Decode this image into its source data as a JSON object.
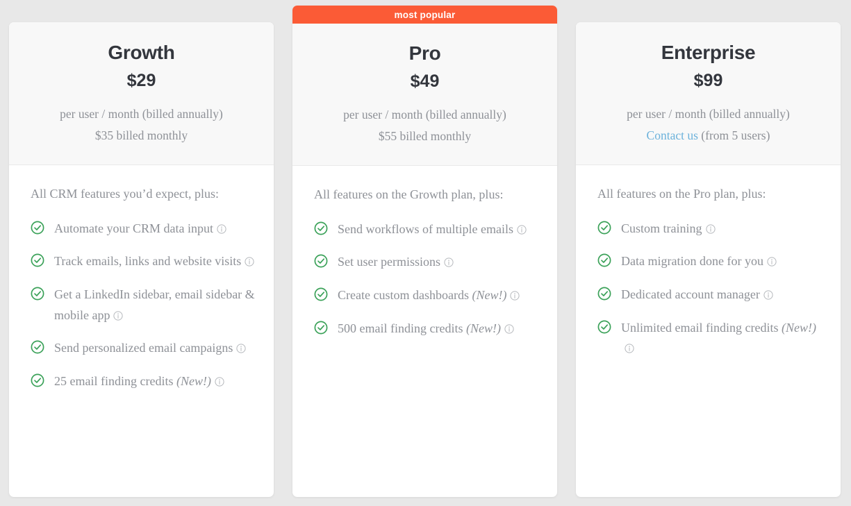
{
  "page": {
    "background_color": "#e8e8e8",
    "accent_orange": "#fb5b36",
    "check_green": "#3aa158",
    "link_blue": "#6cb2db",
    "text_gray": "#8e9197",
    "heading_dark": "#33363d"
  },
  "plans": [
    {
      "id": "growth",
      "ribbon": null,
      "name": "Growth",
      "price": "$29",
      "billing_primary": "per user / month (billed annually)",
      "billing_secondary": "$35 billed monthly",
      "contact_link": null,
      "contact_suffix": null,
      "intro": "All CRM features you’d expect, plus:",
      "features": [
        {
          "text": "Automate your CRM data input",
          "new": null
        },
        {
          "text": "Track emails, links and website visits",
          "new": null
        },
        {
          "text": "Get a LinkedIn sidebar, email sidebar & mobile app",
          "new": null
        },
        {
          "text": "Send personalized email campaigns",
          "new": null
        },
        {
          "text": "25 email finding credits",
          "new": "(New!)"
        }
      ]
    },
    {
      "id": "pro",
      "ribbon": "most popular",
      "name": "Pro",
      "price": "$49",
      "billing_primary": "per user / month (billed annually)",
      "billing_secondary": "$55 billed monthly",
      "contact_link": null,
      "contact_suffix": null,
      "intro": "All features on the Growth plan, plus:",
      "features": [
        {
          "text": "Send workflows of multiple emails",
          "new": null
        },
        {
          "text": "Set user permissions",
          "new": null
        },
        {
          "text": "Create custom dashboards",
          "new": "(New!)"
        },
        {
          "text": "500 email finding credits",
          "new": "(New!)"
        }
      ]
    },
    {
      "id": "enterprise",
      "ribbon": null,
      "name": "Enterprise",
      "price": "$99",
      "billing_primary": "per user / month (billed annually)",
      "billing_secondary": null,
      "contact_link": "Contact us",
      "contact_suffix": " (from 5 users)",
      "intro": "All features on the Pro plan, plus:",
      "features": [
        {
          "text": "Custom training",
          "new": null
        },
        {
          "text": "Data migration done for you",
          "new": null
        },
        {
          "text": "Dedicated account manager",
          "new": null
        },
        {
          "text": "Unlimited email finding credits",
          "new": "(New!)"
        }
      ]
    }
  ]
}
